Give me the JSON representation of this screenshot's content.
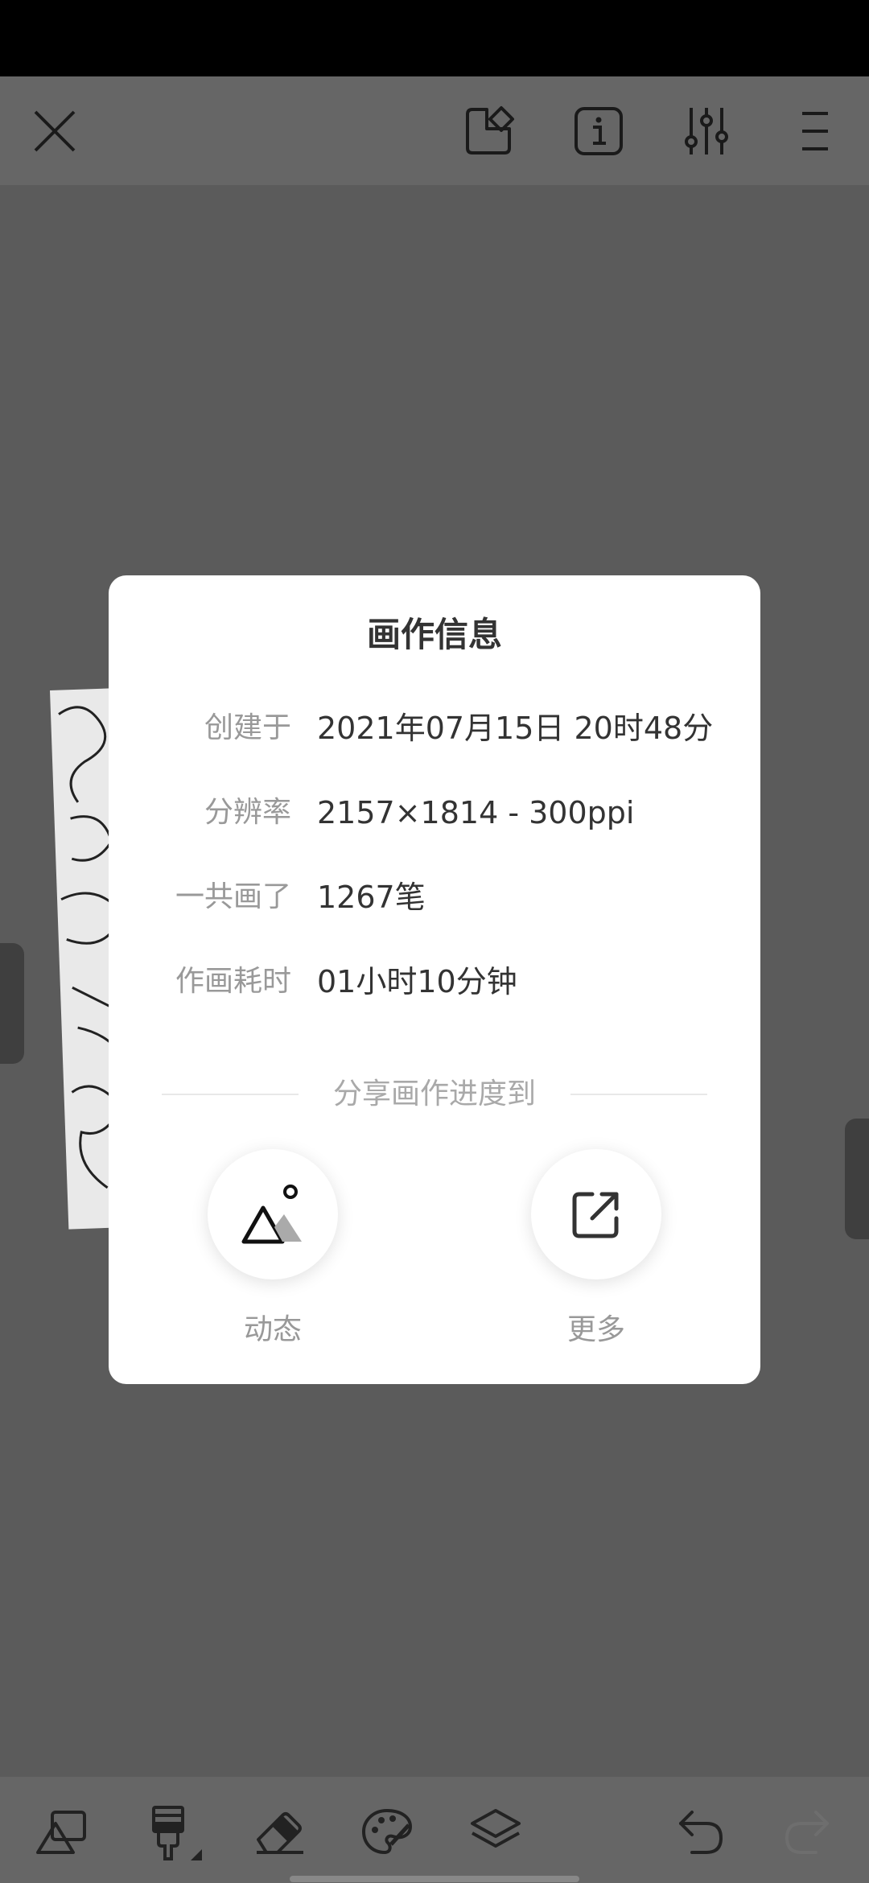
{
  "dialog": {
    "title": "画作信息",
    "rows": [
      {
        "label": "创建于",
        "value": "2021年07月15日 20时48分"
      },
      {
        "label": "分辨率",
        "value": "2157×1814 - 300ppi"
      },
      {
        "label": "一共画了",
        "value": "1267笔"
      },
      {
        "label": "作画耗时",
        "value": "01小时10分钟"
      }
    ],
    "share_heading": "分享画作进度到",
    "share_options": [
      {
        "label": "动态",
        "icon": "mountain-picture-icon"
      },
      {
        "label": "更多",
        "icon": "external-share-icon"
      }
    ]
  },
  "top_toolbar": {
    "icons": [
      "close-icon",
      "canvas-crop-icon",
      "info-icon",
      "sliders-icon",
      "menu-icon"
    ]
  },
  "bottom_toolbar": {
    "icons": [
      "shapes-icon",
      "brush-icon",
      "eraser-icon",
      "palette-icon",
      "layers-icon",
      "undo-icon"
    ]
  },
  "colors": {
    "overlay": "#5b5b5b",
    "dialog_bg": "#ffffff",
    "title_text": "#333333",
    "label_text": "#999999"
  }
}
